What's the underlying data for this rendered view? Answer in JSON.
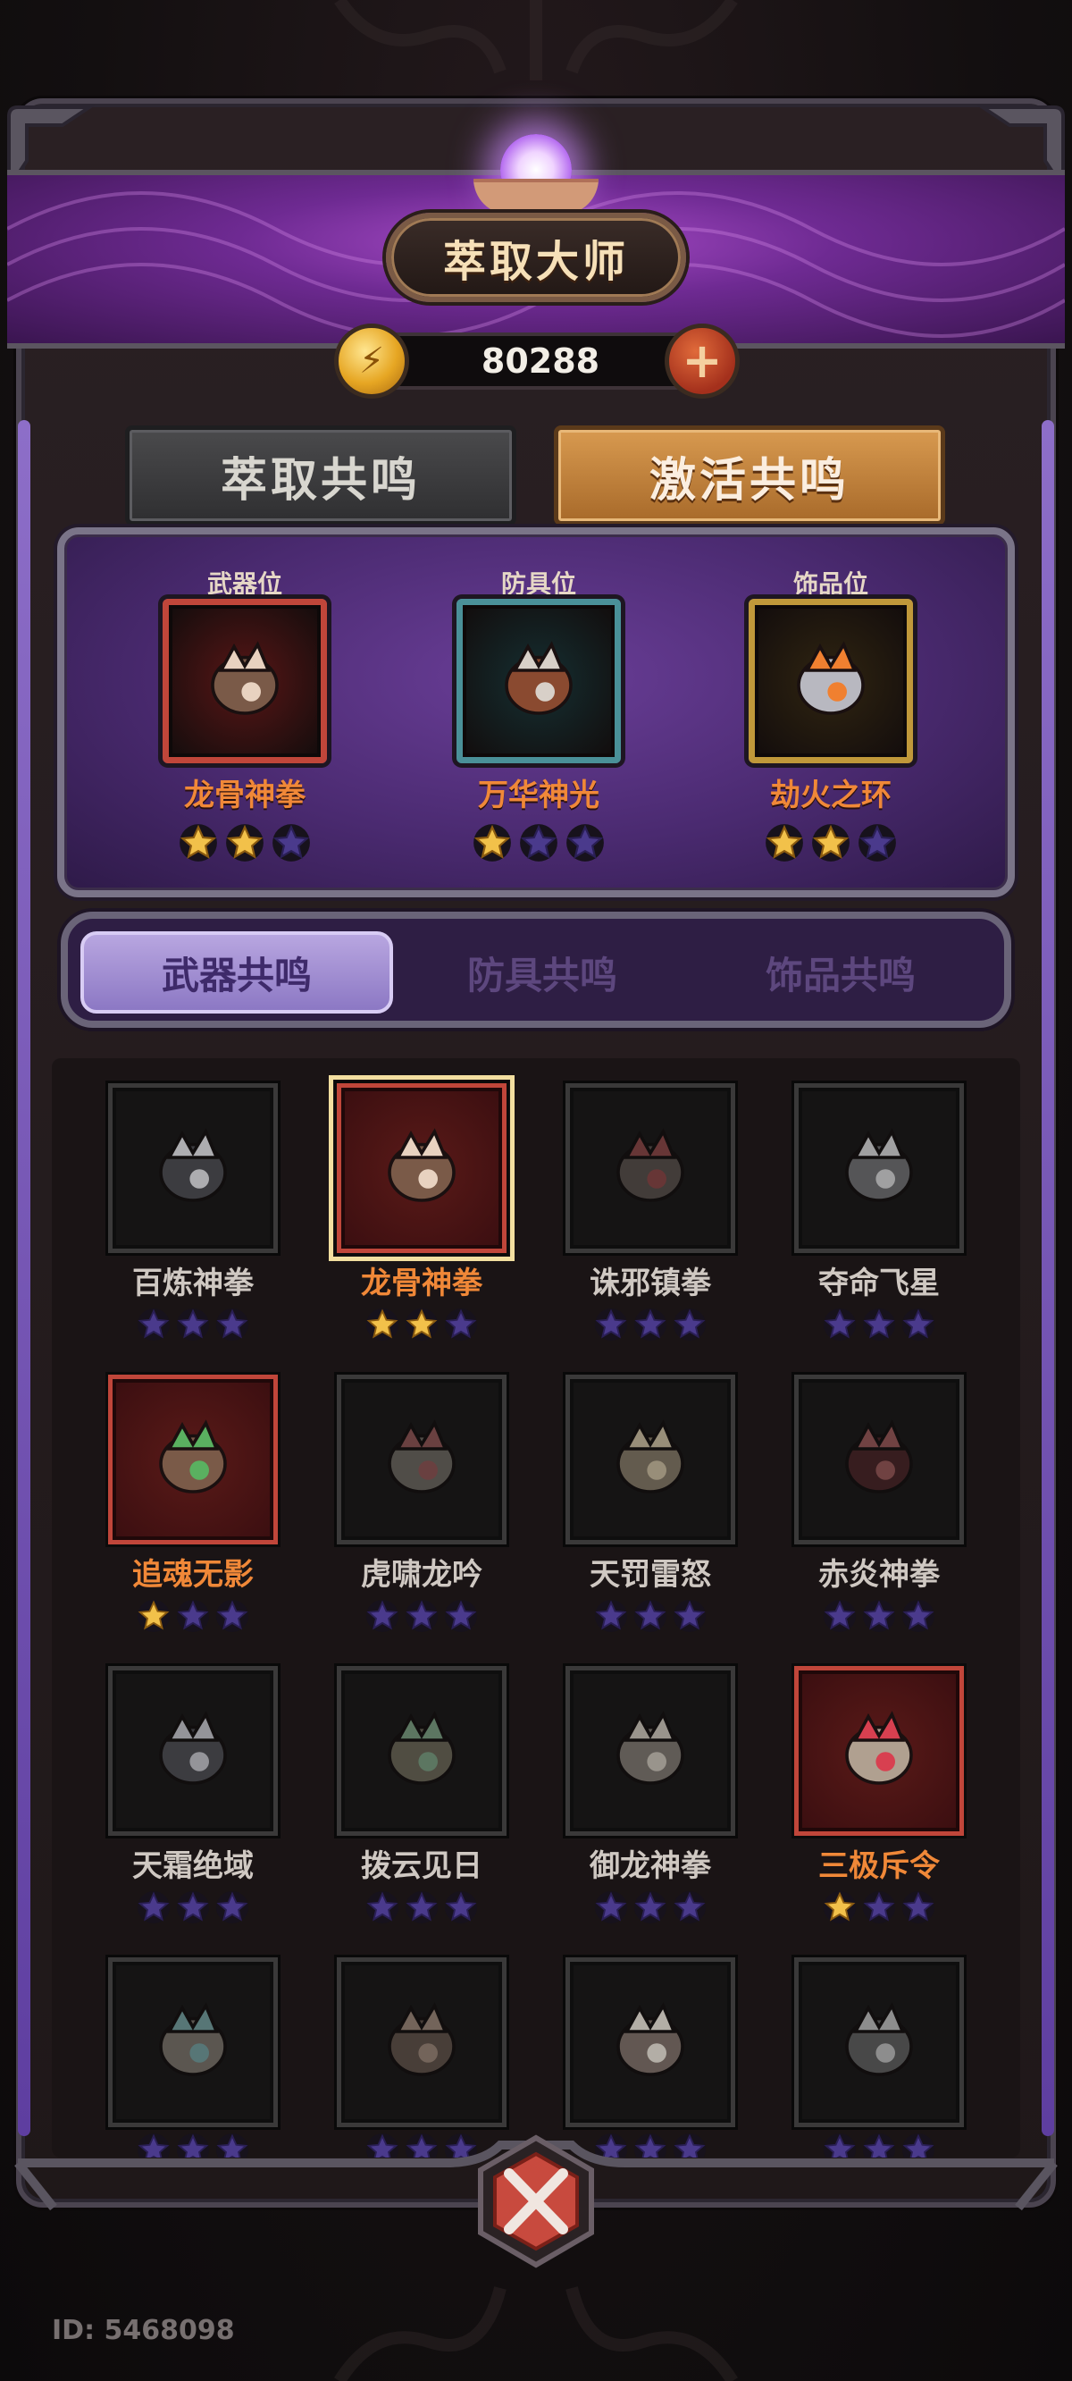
{
  "header": {
    "title": "萃取大师",
    "coins": "80288",
    "coin_icon": "gold-coin-icon",
    "add_icon": "plus-icon"
  },
  "top_tabs": [
    {
      "label": "萃取共鸣",
      "selected": false
    },
    {
      "label": "激活共鸣",
      "selected": true
    }
  ],
  "equipped": [
    {
      "caption": "武器位",
      "name": "龙骨神拳",
      "stars": 2,
      "max_stars": 3,
      "frame": "red",
      "icon": "dragon-bone-fist-icon"
    },
    {
      "caption": "防具位",
      "name": "万华神光",
      "stars": 1,
      "max_stars": 3,
      "frame": "teal",
      "icon": "flower-crown-icon"
    },
    {
      "caption": "饰品位",
      "name": "劫火之环",
      "stars": 2,
      "max_stars": 3,
      "frame": "gold",
      "icon": "fire-ring-icon"
    }
  ],
  "sub_tabs": [
    {
      "label": "武器共鸣",
      "selected": true
    },
    {
      "label": "防具共鸣",
      "selected": false
    },
    {
      "label": "饰品共鸣",
      "selected": false
    }
  ],
  "weapons": [
    {
      "name": "百炼神拳",
      "stars": 0,
      "owned": false,
      "selected": false,
      "icon": "armored-fist-icon"
    },
    {
      "name": "龙骨神拳",
      "stars": 2,
      "owned": true,
      "selected": true,
      "icon": "dragon-bone-fist-icon"
    },
    {
      "name": "诛邪镇拳",
      "stars": 0,
      "owned": false,
      "selected": false,
      "icon": "demon-mask-fist-icon"
    },
    {
      "name": "夺命飞星",
      "stars": 0,
      "owned": false,
      "selected": false,
      "icon": "wolf-gauntlet-icon"
    },
    {
      "name": "追魂无影",
      "stars": 1,
      "owned": true,
      "selected": false,
      "icon": "leaf-fist-icon"
    },
    {
      "name": "虎啸龙吟",
      "stars": 0,
      "owned": false,
      "selected": false,
      "icon": "bagua-fist-icon"
    },
    {
      "name": "天罚雷怒",
      "stars": 0,
      "owned": false,
      "selected": false,
      "icon": "vajra-icon"
    },
    {
      "name": "赤炎神拳",
      "stars": 0,
      "owned": false,
      "selected": false,
      "icon": "crimson-claw-icon"
    },
    {
      "name": "天霜绝域",
      "stars": 0,
      "owned": false,
      "selected": false,
      "icon": "spiked-gauntlet-icon"
    },
    {
      "name": "拨云见日",
      "stars": 0,
      "owned": false,
      "selected": false,
      "icon": "jade-scroll-icon"
    },
    {
      "name": "御龙神拳",
      "stars": 0,
      "owned": false,
      "selected": false,
      "icon": "lantern-icon"
    },
    {
      "name": "三极斥令",
      "stars": 1,
      "owned": true,
      "selected": false,
      "icon": "command-token-icon"
    },
    {
      "name": "",
      "stars": 0,
      "owned": false,
      "selected": false,
      "icon": "feather-gauntlet-icon"
    },
    {
      "name": "",
      "stars": 0,
      "owned": false,
      "selected": false,
      "icon": "prayer-drum-icon"
    },
    {
      "name": "",
      "stars": 0,
      "owned": false,
      "selected": false,
      "icon": "tusk-icon"
    },
    {
      "name": "",
      "stars": 0,
      "owned": false,
      "selected": false,
      "icon": "stone-orb-icon"
    }
  ],
  "footer": {
    "player_id": "ID: 5468098",
    "close_icon": "close-x-icon"
  },
  "colors": {
    "accent_orange": "#f08838",
    "star_gold": "#f2c14a",
    "star_empty": "#4a3a8c",
    "banner_purple": "#6e2a92",
    "active_tab": "#d89a50"
  }
}
